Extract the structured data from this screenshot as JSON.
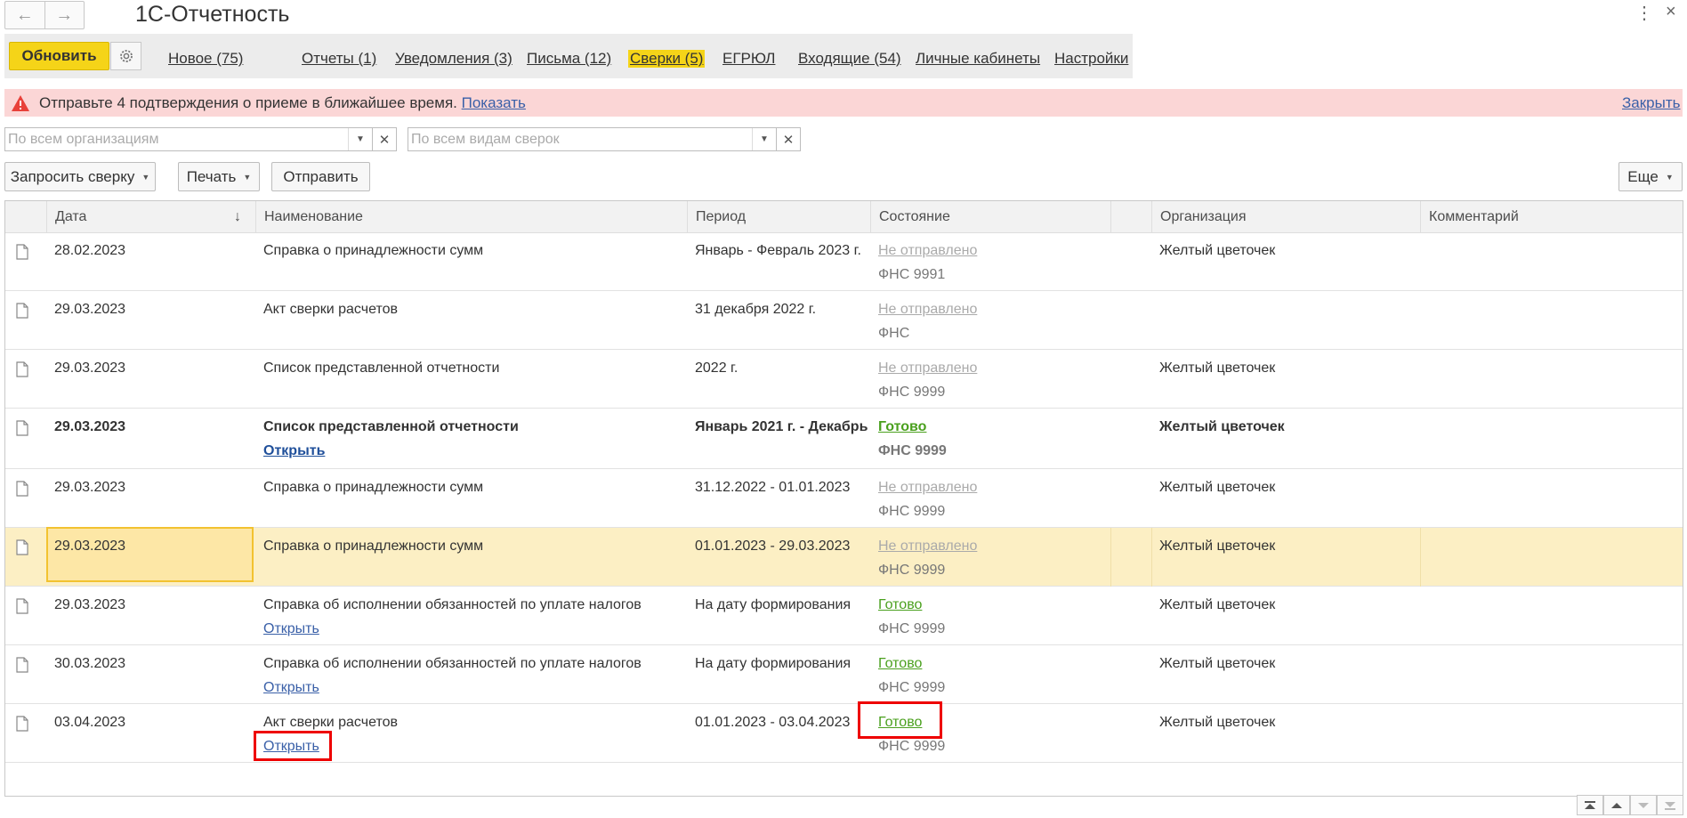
{
  "window": {
    "title": "1С-Отчетность",
    "menu_glyph": "⋮",
    "close_glyph": "×"
  },
  "toolbar": {
    "update_label": "Обновить",
    "new_link": "Новое (75)",
    "nav_links": [
      "Отчеты (1)",
      "Уведомления (3)",
      "Письма (12)",
      "Сверки (5)",
      "ЕГРЮЛ",
      "Входящие (54)",
      "Личные кабинеты",
      "Настройки"
    ],
    "active_link": "Сверки (5)"
  },
  "alert": {
    "text": "Отправьте 4 подтверждения о приеме в ближайшее время.",
    "show_link": "Показать",
    "close_link": "Закрыть",
    "color": "#fbd6d6"
  },
  "filters": {
    "org_placeholder": "По всем организациям",
    "type_placeholder": "По всем видам сверок"
  },
  "commands": {
    "request": "Запросить сверку",
    "print": "Печать",
    "send": "Отправить",
    "more": "Еще"
  },
  "table": {
    "columns": [
      "Дата",
      "Наименование",
      "Период",
      "Состояние",
      "Организация",
      "Комментарий"
    ],
    "sort_glyph": "↓",
    "rows": [
      {
        "date": "28.02.2023",
        "name": "Справка о принадлежности сумм",
        "link": "",
        "period": "Январь - Февраль 2023 г.",
        "status": "Не отправлено",
        "status_type": "not_sent",
        "fns": "ФНС 9991",
        "org": "Желтый цветочек"
      },
      {
        "date": "29.03.2023",
        "name": "Акт сверки расчетов",
        "link": "",
        "period": "31 декабря 2022 г.",
        "status": "Не отправлено",
        "status_type": "not_sent",
        "fns": "ФНС",
        "org": ""
      },
      {
        "date": "29.03.2023",
        "name": "Список представленной отчетности",
        "link": "",
        "period": "2022 г.",
        "status": "Не отправлено",
        "status_type": "not_sent",
        "fns": "ФНС 9999",
        "org": "Желтый цветочек"
      },
      {
        "date": "29.03.2023",
        "name": "Список представленной отчетности",
        "link": "Открыть",
        "period": "Январь 2021 г. - Декабрь",
        "status": "Готово",
        "status_type": "ready",
        "fns": "ФНС 9999",
        "org": "Желтый цветочек"
      },
      {
        "date": "29.03.2023",
        "name": "Справка о принадлежности сумм",
        "link": "",
        "period": "31.12.2022 - 01.01.2023",
        "status": "Не отправлено",
        "status_type": "not_sent",
        "fns": "ФНС 9999",
        "org": "Желтый цветочек"
      },
      {
        "date": "29.03.2023",
        "name": "Справка о принадлежности сумм",
        "link": "",
        "period": "01.01.2023 - 29.03.2023",
        "status": "Не отправлено",
        "status_type": "not_sent",
        "fns": "ФНС 9999",
        "org": "Желтый цветочек"
      },
      {
        "date": "29.03.2023",
        "name": "Справка об исполнении обязанностей по уплате налогов",
        "link": "Открыть",
        "period": "На дату формирования",
        "status": "Готово",
        "status_type": "ready",
        "fns": "ФНС 9999",
        "org": "Желтый цветочек"
      },
      {
        "date": "30.03.2023",
        "name": "Справка об исполнении обязанностей по уплате налогов",
        "link": "Открыть",
        "period": "На дату формирования",
        "status": "Готово",
        "status_type": "ready",
        "fns": "ФНС 9999",
        "org": "Желтый цветочек"
      },
      {
        "date": "03.04.2023",
        "name": "Акт сверки расчетов",
        "link": "Открыть",
        "period": "01.01.2023 - 03.04.2023",
        "status": "Готово",
        "status_type": "ready",
        "fns": "ФНС 9999",
        "org": "Желтый цветочек"
      }
    ],
    "bold_row": 3,
    "selected_row": 5
  },
  "colors": {
    "accent_yellow": "#f5d418",
    "ready_green": "#4aa01e",
    "link_blue": "#3a60a8",
    "highlight_red": "#ee0000"
  }
}
